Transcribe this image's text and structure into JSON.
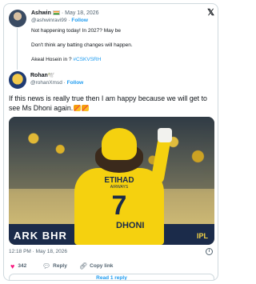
{
  "parent_tweet": {
    "name": "Ashwin",
    "separator": "·",
    "date": "May 18, 2026",
    "handle": "@ashwinravi99",
    "follow_label": "Follow",
    "lines": [
      "Not happening today! In 2027? May be",
      "Don't think any batting changes will happen.",
      "Akeal Hosein in ?"
    ],
    "hashtag": "#CSKVSRH",
    "flag_icon": "india-flag-icon"
  },
  "platform_logo": "𝕏",
  "main_tweet": {
    "name": "Rohan🕊️",
    "handle": "@rohanXmsd",
    "follow_label": "Follow",
    "text": "If this news is really true then I am happy because we will get to see Ms Dhoni again.",
    "photo": {
      "jersey_sponsor": "ETIHAD",
      "jersey_sponsor_sub": "AIRWAYS",
      "jersey_number": "7",
      "jersey_name": "DHONI",
      "board_text": "ARK BHR",
      "board_logo": "IPL"
    }
  },
  "meta": {
    "time": "12:18 PM",
    "separator": "·",
    "date": "May 18, 2026"
  },
  "actions": {
    "likes": "342",
    "reply_label": "Reply",
    "copy_label": "Copy link"
  },
  "read_replies_label": "Read 1 reply",
  "colors": {
    "accent": "#1d9bf0",
    "like": "#f91880",
    "muted": "#536471",
    "border": "#cfd9de"
  }
}
